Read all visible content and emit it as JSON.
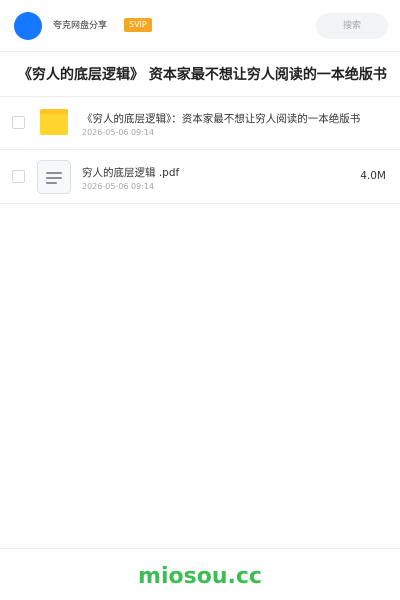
{
  "header": {
    "username": "夸克网盘分享",
    "badge": "SVIP",
    "search_placeholder": "搜索",
    "accent_color": "#1677ff",
    "badge_color": "#f5a623"
  },
  "share": {
    "title": "《穷人的底层逻辑》 资本家最不想让穷人阅读的一本绝版书"
  },
  "files": [
    {
      "icon": "folder-icon",
      "name": "《穷人的底层逻辑》：资本家最不想让穷人阅读的一本绝版书",
      "date": "2026-05-06 09:14",
      "size": ""
    },
    {
      "icon": "document-icon",
      "name": "穷人的底层逻辑 .pdf",
      "date": "2026-05-06 09:14",
      "size": "4.0M"
    }
  ],
  "footer": {
    "logo_text": "miosou.cc",
    "logo_color": "#3fbd55"
  }
}
